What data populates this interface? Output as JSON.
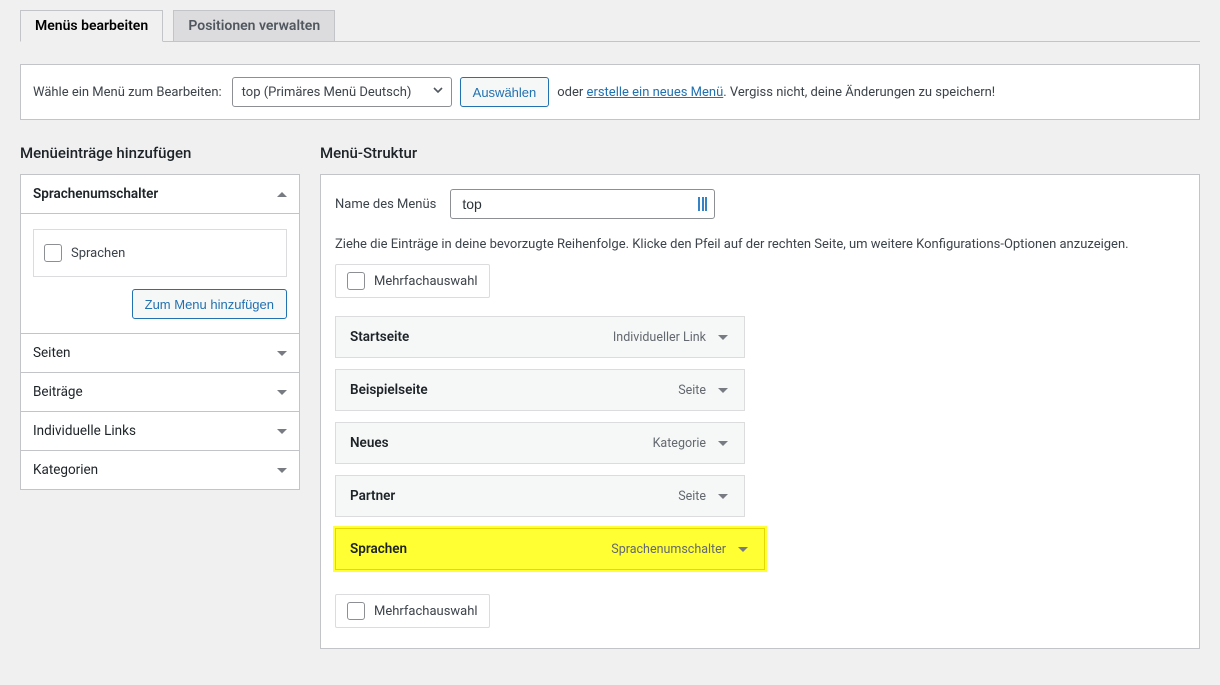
{
  "tabs": {
    "edit": "Menüs bearbeiten",
    "manage": "Positionen verwalten"
  },
  "manage": {
    "label": "Wähle ein Menü zum Bearbeiten:",
    "selected": "top (Primäres Menü Deutsch)",
    "select_button": "Auswählen",
    "or": "oder",
    "create_link": "erstelle ein neues Menü",
    "suffix": ". Vergiss nicht, deine Änderungen zu speichern!"
  },
  "left": {
    "heading": "Menüeinträge hinzufügen",
    "switcher_title": "Sprachenumschalter",
    "switcher_option": "Sprachen",
    "add_button": "Zum Menu hinzufügen",
    "sections": [
      "Seiten",
      "Beiträge",
      "Individuelle Links",
      "Kategorien"
    ]
  },
  "right": {
    "heading": "Menü-Struktur",
    "name_label": "Name des Menüs",
    "name_value": "top",
    "instructions": "Ziehe die Einträge in deine bevorzugte Reihenfolge. Klicke den Pfeil auf der rechten Seite, um weitere Konfigurations-Optionen anzuzeigen.",
    "bulk_label": "Mehrfachauswahl",
    "items": [
      {
        "title": "Startseite",
        "type": "Individueller Link",
        "highlight": false
      },
      {
        "title": "Beispielseite",
        "type": "Seite",
        "highlight": false
      },
      {
        "title": "Neues",
        "type": "Kategorie",
        "highlight": false
      },
      {
        "title": "Partner",
        "type": "Seite",
        "highlight": false
      },
      {
        "title": "Sprachen",
        "type": "Sprachenumschalter",
        "highlight": true
      }
    ],
    "bulk_label_bottom": "Mehrfachauswahl"
  }
}
